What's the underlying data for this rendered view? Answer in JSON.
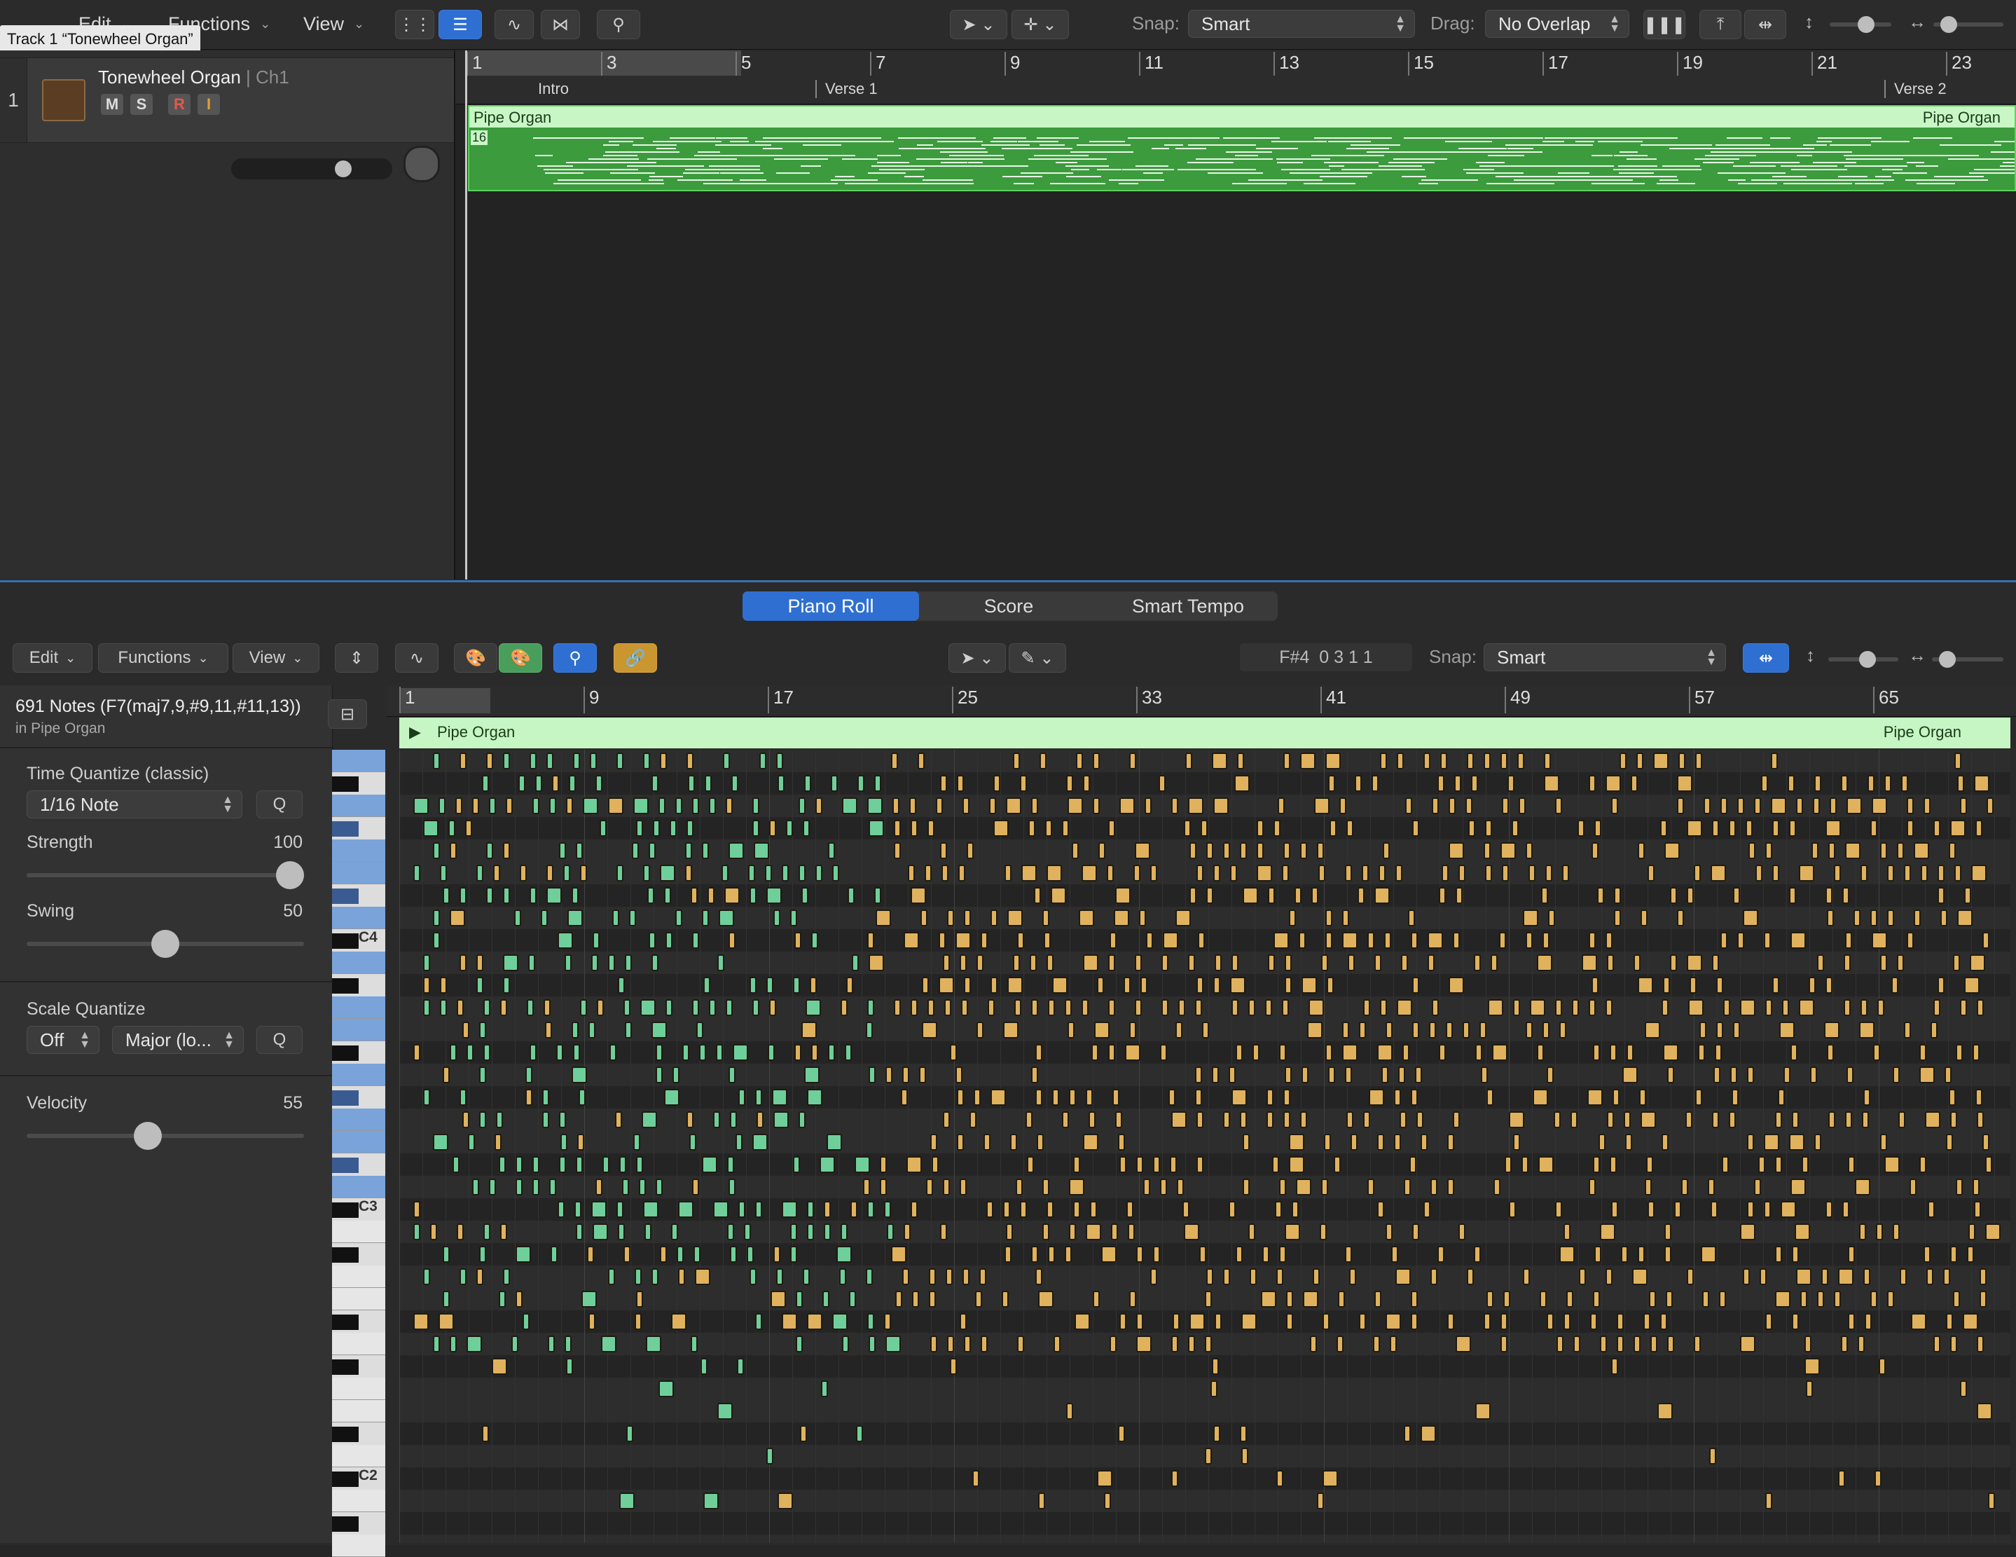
{
  "tooltip": "Track 1 “Tonewheel Organ”",
  "top_toolbar": {
    "menus": [
      "Edit",
      "Functions",
      "View"
    ],
    "snap_label": "Snap:",
    "snap_value": "Smart",
    "drag_label": "Drag:",
    "drag_value": "No Overlap"
  },
  "arrange": {
    "ruler_bars": [
      "1",
      "3",
      "5",
      "7",
      "9",
      "11",
      "13",
      "15",
      "17",
      "19",
      "21",
      "23"
    ],
    "markers": [
      "Intro",
      "Verse 1",
      "Verse 2"
    ],
    "track": {
      "number": "1",
      "name": "Tonewheel Organ",
      "channel": "| Ch1",
      "buttons": [
        "M",
        "S",
        "R",
        "I"
      ]
    },
    "region": {
      "name": "Pipe Organ",
      "name_end": "Pipe Organ",
      "loop_badge": "16"
    }
  },
  "editor": {
    "tabs": [
      "Piano Roll",
      "Score",
      "Smart Tempo"
    ],
    "active_tab": "Piano Roll",
    "menus": [
      "Edit",
      "Functions",
      "View"
    ],
    "position_readout": "F#4  0 3 1 1",
    "snap_label": "Snap:",
    "snap_value": "Smart",
    "ruler_bars": [
      "1",
      "9",
      "17",
      "25",
      "33",
      "41",
      "49",
      "57",
      "65"
    ],
    "region_name": "Pipe Organ",
    "region_name_end": "Pipe Organ",
    "piano_labels": [
      "C4",
      "C3",
      "C2"
    ]
  },
  "inspector": {
    "notes_title": "691 Notes (F7(maj7,9,#9,11,#11,13))",
    "notes_sub": "in Pipe Organ",
    "time_quantize_label": "Time Quantize (classic)",
    "time_quantize_value": "1/16 Note",
    "q_label": "Q",
    "strength_label": "Strength",
    "strength_value": "100",
    "strength_level": 1.0,
    "swing_label": "Swing",
    "swing_value": "50",
    "swing_level": 0.5,
    "scale_quantize_label": "Scale Quantize",
    "scale_off": "Off",
    "scale_mode": "Major (lo...",
    "velocity_label": "Velocity",
    "velocity_value": "55",
    "velocity_level": 0.43
  },
  "colors": {
    "selected_note": "#6fcf9a",
    "unselected_note": "#e0b25e",
    "region_green": "#3c9b3d",
    "accent_blue": "#2f6fd1"
  }
}
